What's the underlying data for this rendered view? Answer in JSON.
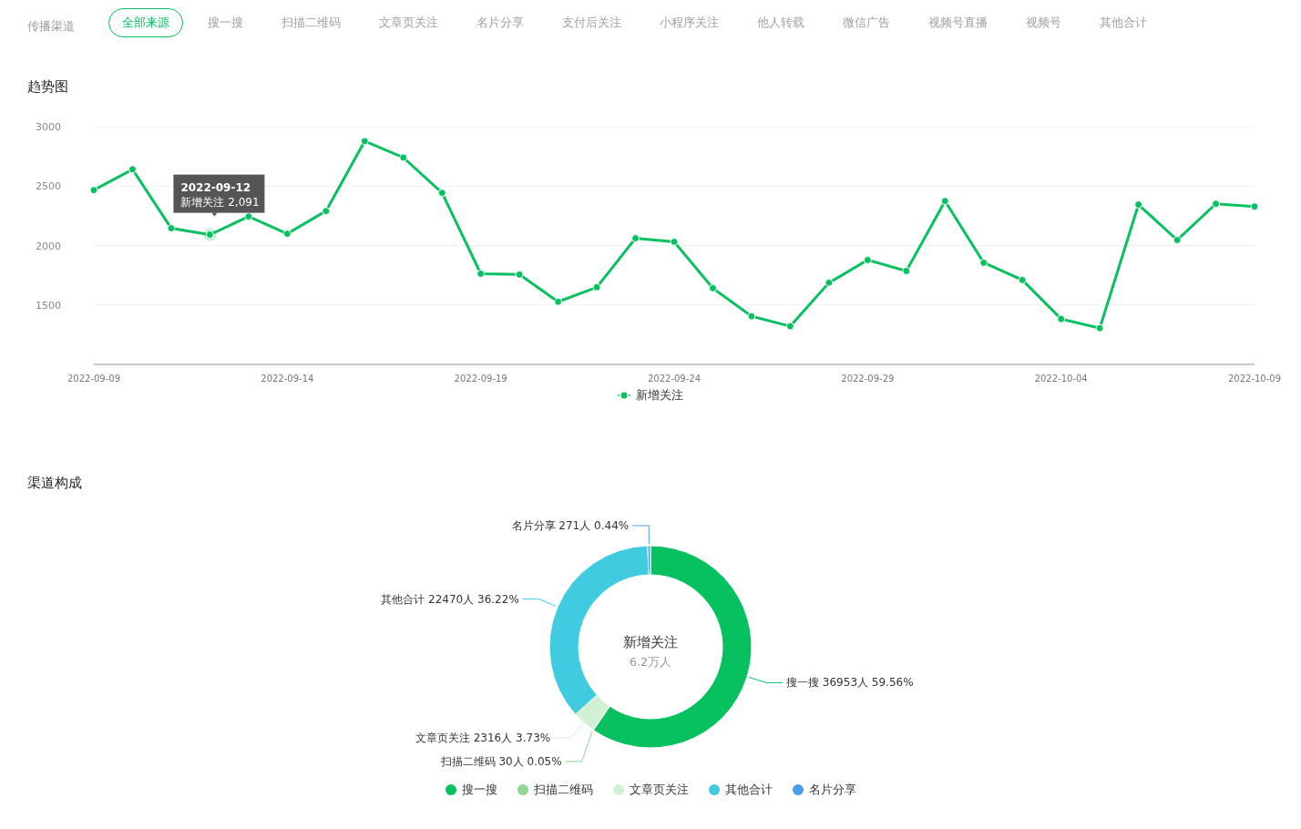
{
  "channel_filter": {
    "label": "传播渠道",
    "tabs": [
      {
        "label": "全部来源",
        "selected": true
      },
      {
        "label": "搜一搜",
        "selected": false
      },
      {
        "label": "扫描二维码",
        "selected": false
      },
      {
        "label": "文章页关注",
        "selected": false
      },
      {
        "label": "名片分享",
        "selected": false
      },
      {
        "label": "支付后关注",
        "selected": false
      },
      {
        "label": "小程序关注",
        "selected": false
      },
      {
        "label": "他人转载",
        "selected": false
      },
      {
        "label": "微信广告",
        "selected": false
      },
      {
        "label": "视频号直播",
        "selected": false
      },
      {
        "label": "视频号",
        "selected": false
      },
      {
        "label": "其他合计",
        "selected": false
      }
    ]
  },
  "trend": {
    "title": "趋势图",
    "chart_data": {
      "type": "line",
      "x": [
        "2022-09-09",
        "2022-09-10",
        "2022-09-11",
        "2022-09-12",
        "2022-09-13",
        "2022-09-14",
        "2022-09-15",
        "2022-09-16",
        "2022-09-17",
        "2022-09-18",
        "2022-09-19",
        "2022-09-20",
        "2022-09-21",
        "2022-09-22",
        "2022-09-23",
        "2022-09-24",
        "2022-09-25",
        "2022-09-26",
        "2022-09-27",
        "2022-09-28",
        "2022-09-29",
        "2022-09-30",
        "2022-10-01",
        "2022-10-02",
        "2022-10-03",
        "2022-10-04",
        "2022-10-05",
        "2022-10-06",
        "2022-10-07",
        "2022-10-08",
        "2022-10-09"
      ],
      "series": [
        {
          "name": "新增关注",
          "color": "#07c160",
          "marker": "circle",
          "values": [
            2466,
            2641,
            2145,
            2091,
            2244,
            2099,
            2290,
            2878,
            2740,
            2443,
            1763,
            1756,
            1527,
            1649,
            2061,
            2031,
            1641,
            1405,
            1321,
            1687,
            1878,
            1786,
            2374,
            1855,
            1710,
            1382,
            1305,
            2344,
            2046,
            2351,
            2328
          ]
        }
      ],
      "xlim": [
        "2022-09-09",
        "2022-10-09"
      ],
      "ylim": [
        1000,
        3000
      ],
      "yticks": [
        1500,
        2000,
        2500,
        3000
      ],
      "xticks": [
        "2022-09-09",
        "2022-09-14",
        "2022-09-19",
        "2022-09-24",
        "2022-09-29",
        "2022-10-04",
        "2022-10-09"
      ],
      "grid": true,
      "annotations": [
        "2022-09-12",
        "新增关注 2,091"
      ]
    }
  },
  "composition": {
    "title": "渠道构成",
    "center_title": "新增关注",
    "center_value": "6.2万人",
    "chart_data": {
      "type": "donut",
      "categories": [
        "搜一搜",
        "扫描二维码",
        "文章页关注",
        "其他合计",
        "名片分享"
      ],
      "values": [
        36953,
        30,
        2316,
        22470,
        271
      ],
      "colors": [
        "#07c160",
        "#8fd694",
        "#d2f0d4",
        "#40cbe0",
        "#4a9fe8"
      ],
      "value_labels": [
        "搜一搜 36953人 59.56%",
        "扫描二维码 30人 0.05%",
        "文章页关注 2316人 3.73%",
        "其他合计 22470人 36.22%",
        "名片分享 271人 0.44%"
      ]
    }
  }
}
